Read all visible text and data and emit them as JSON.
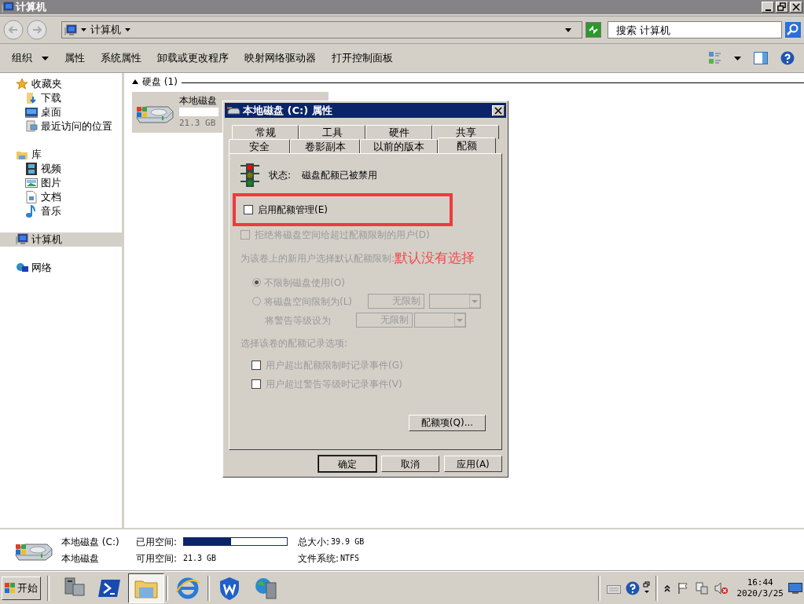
{
  "window": {
    "title": "计算机"
  },
  "nav": {
    "address": "计算机",
    "search_placeholder": "搜索 计算机"
  },
  "toolbar": [
    {
      "label": "组织",
      "dropdown": true
    },
    {
      "label": "属性",
      "dropdown": false
    },
    {
      "label": "系统属性",
      "dropdown": false
    },
    {
      "label": "卸载或更改程序",
      "dropdown": false
    },
    {
      "label": "映射网络驱动器",
      "dropdown": false
    },
    {
      "label": "打开控制面板",
      "dropdown": false
    }
  ],
  "sidebar": [
    {
      "label": "收藏夹",
      "selected": false,
      "children": [
        {
          "label": "下载"
        },
        {
          "label": "桌面"
        },
        {
          "label": "最近访问的位置"
        }
      ]
    },
    {
      "label": "库",
      "selected": false,
      "children": [
        {
          "label": "视频"
        },
        {
          "label": "图片"
        },
        {
          "label": "文档"
        },
        {
          "label": "音乐"
        }
      ]
    },
    {
      "label": "计算机",
      "selected": true
    },
    {
      "label": "网络",
      "selected": false
    }
  ],
  "content": {
    "group": {
      "label": "硬盘 (1)",
      "expanded": true
    },
    "tile": {
      "name": "本地磁盘",
      "free": "21.3 GB"
    }
  },
  "dialog": {
    "title": "本地磁盘 (C:) 属性",
    "tab_rows": [
      [
        {
          "label": "常规",
          "selected": false
        },
        {
          "label": "工具",
          "selected": false
        },
        {
          "label": "硬件",
          "selected": false
        },
        {
          "label": "共享",
          "selected": false
        }
      ],
      [
        {
          "label": "安全",
          "selected": false
        },
        {
          "label": "卷影副本",
          "selected": false
        },
        {
          "label": "以前的版本",
          "selected": false
        },
        {
          "label": "配额",
          "selected": true
        }
      ]
    ],
    "status_label": "状态:",
    "status": "磁盘配额已被禁用",
    "enable": {
      "label": "启用配额管理(E)",
      "checked": false,
      "disabled": false
    },
    "deny": {
      "label": "拒绝将磁盘空间给超过配额限制的用户(D)",
      "checked": false,
      "disabled": true
    },
    "prompt": "为该卷上的新用户选择默认配额限制:",
    "radios": [
      {
        "label": "不限制磁盘使用(O)",
        "selected": true
      },
      {
        "label": "将磁盘空间限制为(L)",
        "selected": false,
        "value": "无限制"
      }
    ],
    "warning": {
      "label": "将警告等级设为",
      "value": "无限制"
    },
    "log_label": "选择该卷的配额记录选项:",
    "log_options": [
      {
        "label": "用户超出配额限制时记录事件(G)",
        "checked": false
      },
      {
        "label": "用户超过警告等级时记录事件(V)",
        "checked": false
      }
    ],
    "entries_button": "配额项(Q)...",
    "buttons": [
      "确定",
      "取消",
      "应用(A)"
    ],
    "annotation": "默认没有选择"
  },
  "details": {
    "name": "本地磁盘 (C:)",
    "type": "本地磁盘",
    "used_label": "已用空间:",
    "level": 0.46,
    "free_label": "可用空间:",
    "free": "21.3 GB",
    "total_label": "总大小:",
    "total": "39.9 GB",
    "fs_label": "文件系统:",
    "fs": "NTFS"
  },
  "taskbar": {
    "start": "开始",
    "apps": [
      {
        "selected": false
      },
      {
        "selected": false
      },
      {
        "selected": true
      },
      {
        "selected": false
      },
      {
        "selected": false
      },
      {
        "selected": false
      }
    ],
    "time": "16:44",
    "date": "2020/3/25"
  }
}
